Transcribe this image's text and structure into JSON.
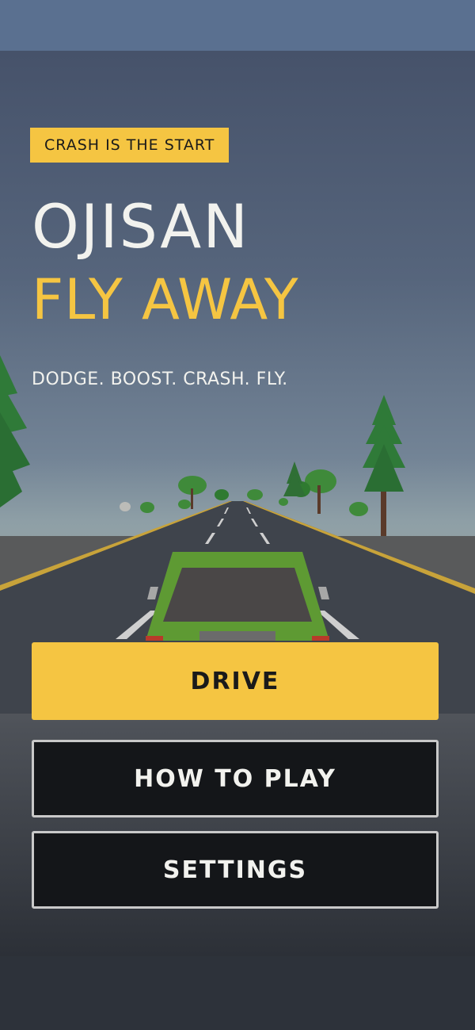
{
  "tagline": "CRASH IS THE START",
  "title": {
    "line1": "OJISAN",
    "line2": "FLY AWAY"
  },
  "subtitle": "DODGE. BOOST. CRASH. FLY.",
  "buttons": {
    "drive": "DRIVE",
    "how_to_play": "HOW TO PLAY",
    "settings": "SETTINGS"
  },
  "colors": {
    "accent": "#f5c542",
    "text": "#f2f2ee",
    "button_dark": "#141619",
    "car": "#5e9a33"
  }
}
